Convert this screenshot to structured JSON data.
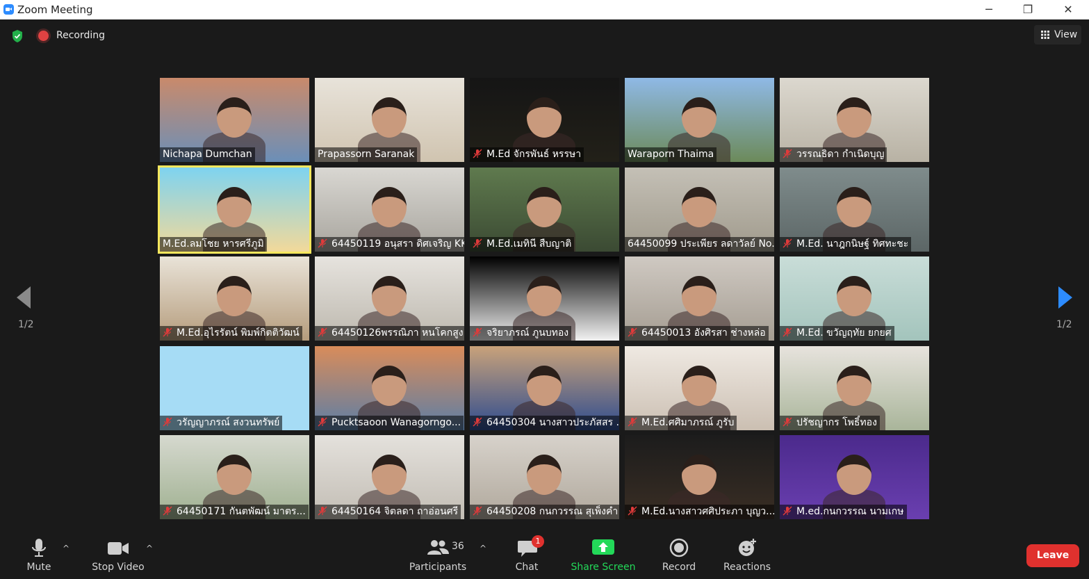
{
  "window": {
    "title": "Zoom Meeting",
    "minimize": "─",
    "restore": "❐",
    "close": "✕"
  },
  "topbar": {
    "recording_label": "Recording",
    "view_label": "View"
  },
  "pager": {
    "label": "1/2"
  },
  "participants": [
    {
      "name": "Nichapa Dumchan",
      "muted": false,
      "bg": "#c98a6b",
      "bg2": "#6b8fb8"
    },
    {
      "name": "Prapassorn Saranak",
      "muted": false,
      "bg": "#e8e3da",
      "bg2": "#d0c4b0"
    },
    {
      "name": "M.Ed จักรพันธ์ หรรษา",
      "muted": true,
      "bg": "#151515",
      "bg2": "#222018"
    },
    {
      "name": "Waraporn Thaima",
      "muted": false,
      "bg": "#8fb9e6",
      "bg2": "#6c8a5a"
    },
    {
      "name": "วรรณธิดา กำเนิดบุญ",
      "muted": true,
      "bg": "#dcd8cf",
      "bg2": "#b8b2a4"
    },
    {
      "name": "M.Ed.ลมโชย หารศรีภูมิ",
      "muted": false,
      "bg": "#7ed3f0",
      "bg2": "#f2d99a",
      "active": true
    },
    {
      "name": "64450119 อนุสรา ดิศเจริญ KK",
      "muted": true,
      "bg": "#d9d7d2",
      "bg2": "#a8a59e"
    },
    {
      "name": "M.Ed.เมทินี สืบญาติ",
      "muted": true,
      "bg": "#5f7a4e",
      "bg2": "#3b4a33"
    },
    {
      "name": "64450099 ประเพียร ลดาวัลย์ No...",
      "muted": false,
      "bg": "#c4c0b6",
      "bg2": "#a09a8c"
    },
    {
      "name": "M.Ed. นาฎกนิษฐ์ ทิศทะชะ",
      "muted": true,
      "bg": "#7f8c8c",
      "bg2": "#5c6666"
    },
    {
      "name": "M.Ed.อุไรรัตน์ พิมพ์กิตติวัฒน์",
      "muted": true,
      "bg": "#e9e3d8",
      "bg2": "#b59c7c"
    },
    {
      "name": "64450126พรรณิภา หนโคกสูง",
      "muted": true,
      "bg": "#e6e3de",
      "bg2": "#bdb8ae"
    },
    {
      "name": "จริยาภรณ์ ภูนบทอง",
      "muted": true,
      "bg": "#000000",
      "bg2": "#f2f2f2"
    },
    {
      "name": "64450013 อังศิรสา ช่างหล่อ",
      "muted": true,
      "bg": "#cfc9c2",
      "bg2": "#a59d92"
    },
    {
      "name": "M.Ed. ขวัญฤทัย ยกยศ",
      "muted": true,
      "bg": "#c9ddd8",
      "bg2": "#a3c4bc"
    },
    {
      "name": "วรัญญาภรณ์ สงวนทรัพย์",
      "muted": true,
      "bg": "#a6dcf5",
      "bg2": "#a6dcf5",
      "empty": true
    },
    {
      "name": "Pucktsaoon Wanagorngo...",
      "muted": true,
      "bg": "#d98c5a",
      "bg2": "#5c7ea6"
    },
    {
      "name": "64450304 นางสาวประภัสสร ...",
      "muted": true,
      "bg": "#c9a27a",
      "bg2": "#2e4c8f"
    },
    {
      "name": "M.Ed.ศศิมาภรณ์ ภูรับ",
      "muted": true,
      "bg": "#efe9e2",
      "bg2": "#cbbfb2"
    },
    {
      "name": "ปรัชญากร โพธิ์ทอง",
      "muted": true,
      "bg": "#e7e3dd",
      "bg2": "#a9b59a"
    },
    {
      "name": "64450171 กันตพัฒน์ มาตร...",
      "muted": true,
      "bg": "#d6d9cf",
      "bg2": "#9fb090"
    },
    {
      "name": "64450164 จิตลดา ถาอ่อนศรี",
      "muted": true,
      "bg": "#e4e1dc",
      "bg2": "#c2bdb4"
    },
    {
      "name": "64450208 กนกวรรณ สุเพ็งคำ",
      "muted": true,
      "bg": "#d7d2cb",
      "bg2": "#b0a89c"
    },
    {
      "name": "M.Ed.นางสาวศศิประภา บุญว...",
      "muted": true,
      "bg": "#1c1c1c",
      "bg2": "#3a2e24"
    },
    {
      "name": "M.ed.กนกวรรณ นามเกษ",
      "muted": true,
      "bg": "#4b2a8c",
      "bg2": "#6a3fb0"
    }
  ],
  "toolbar": {
    "mute": "Mute",
    "stop_video": "Stop Video",
    "participants": "Participants",
    "participant_count": "36",
    "chat": "Chat",
    "chat_badge": "1",
    "share_screen": "Share Screen",
    "record": "Record",
    "reactions": "Reactions",
    "leave": "Leave"
  },
  "colors": {
    "share_green": "#23d959",
    "leave_red": "#e0312e",
    "active_outline": "#f5e75d",
    "nav_blue": "#2d8cff"
  }
}
